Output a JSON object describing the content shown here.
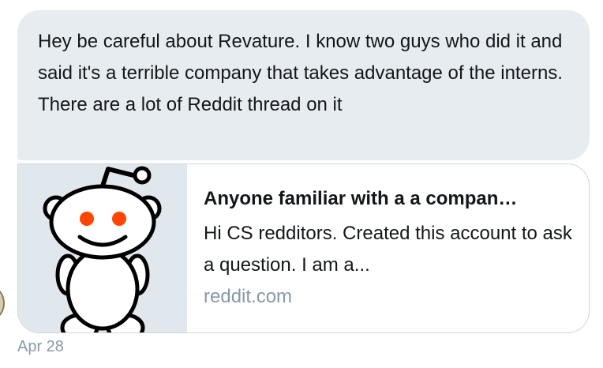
{
  "message": {
    "text": "Hey be careful about Revature. I know two guys who did it and said it's a terrible company that takes advantage of the interns. There are a lot of Reddit thread on it",
    "timestamp": "Apr 28"
  },
  "link_card": {
    "image_icon": "reddit-alien-icon",
    "title": "Anyone familiar with a a compan…",
    "description": "Hi CS redditors. Created this account to ask a question. I am a...",
    "domain": "reddit.com"
  },
  "colors": {
    "bubble_background": "#e6ecf0",
    "card_border": "#ccd6dd",
    "muted_text": "#8899a6",
    "reddit_eye": "#ff4500"
  }
}
